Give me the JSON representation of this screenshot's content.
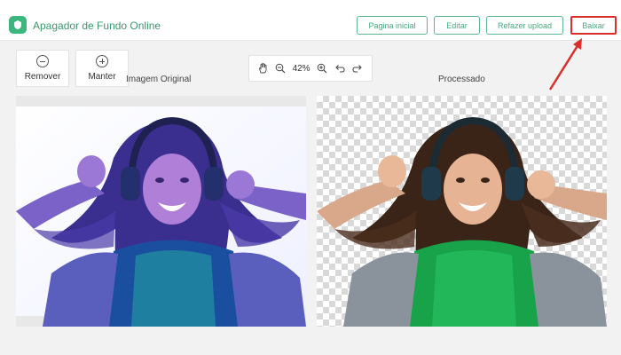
{
  "header": {
    "app_title": "Apagador de Fundo Online",
    "buttons": {
      "home": "Pagina inicial",
      "edit": "Editar",
      "reupload": "Refazer upload",
      "download": "Baixar"
    }
  },
  "tools": {
    "remove": "Remover",
    "keep": "Manter"
  },
  "zoom": {
    "level": "42%"
  },
  "panels": {
    "original_label": "Imagem Original",
    "processed_label": "Processado"
  },
  "colors": {
    "accent": "#3bb77e",
    "highlight": "#d9302c"
  }
}
